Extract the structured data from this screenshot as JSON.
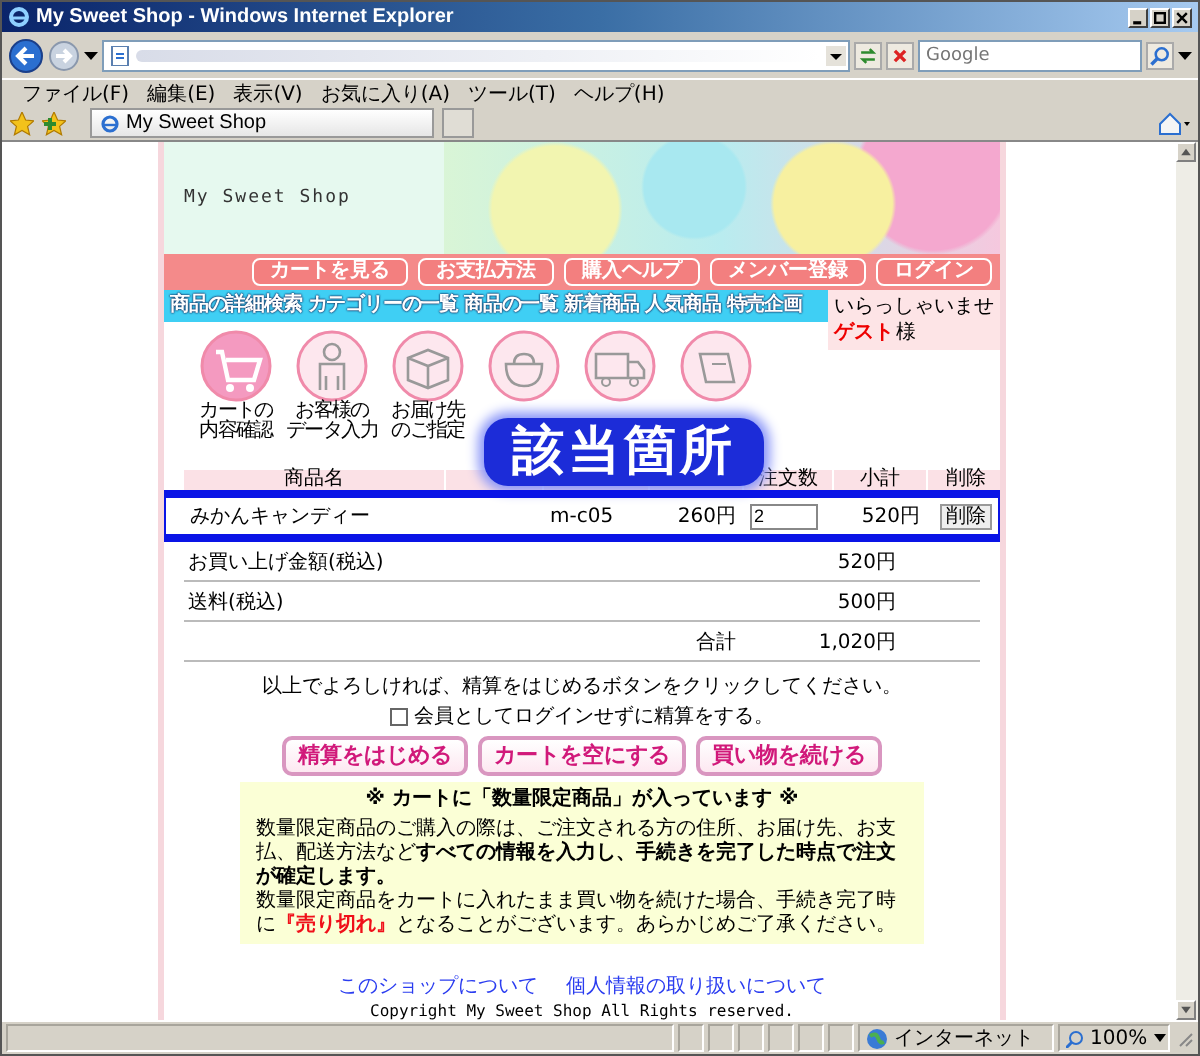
{
  "window": {
    "title": "My Sweet Shop - Windows Internet Explorer"
  },
  "search": {
    "placeholder": "Google"
  },
  "menu": [
    "ファイル(F)",
    "編集(E)",
    "表示(V)",
    "お気に入り(A)",
    "ツール(T)",
    "ヘルプ(H)"
  ],
  "tab": {
    "label": "My Sweet Shop"
  },
  "site": {
    "logo": "My Sweet Shop",
    "top_nav": [
      "カートを見る",
      "お支払方法",
      "購入ヘルプ",
      "メンバー登録",
      "ログイン"
    ],
    "sub_nav": [
      "商品の詳細検索",
      "カテゴリーの一覧",
      "商品の一覧",
      "新着商品",
      "人気商品",
      "特売企画"
    ],
    "greeting": {
      "text": "いらっしゃいませ",
      "user": "ゲスト",
      "suffix": "様"
    }
  },
  "steps": [
    {
      "label": [
        "カートの",
        "内容確認"
      ],
      "selected": true
    },
    {
      "label": [
        "お客様の",
        "データ入力"
      ],
      "selected": false
    },
    {
      "label": [
        "お届け先",
        "のご指定"
      ],
      "selected": false
    },
    {
      "selected": false
    },
    {
      "selected": false
    },
    {
      "selected": false
    }
  ],
  "callout": "該当箇所",
  "cart": {
    "columns": [
      "商品名",
      null,
      null,
      null,
      "注文数",
      "小計",
      "削除"
    ],
    "rows": [
      {
        "name": "みかんキャンディー",
        "model": "m-c05",
        "price": "260円",
        "quantity": "2",
        "subtotal": "520円",
        "remove": "削除"
      }
    ],
    "summary": [
      {
        "kind": "line",
        "label": "お買い上げ金額(税込)",
        "value": "520円"
      },
      {
        "kind": "line",
        "label": "送料(税込)",
        "value": "500円"
      },
      {
        "kind": "total",
        "label": "合計",
        "value": "1,020円"
      }
    ]
  },
  "instruction": "以上でよろしければ、精算をはじめるボタンをクリックしてください。",
  "guest_checkout": {
    "label": "会員としてログインせずに精算をする。",
    "checked": false
  },
  "buttons": [
    "精算をはじめる",
    "カートを空にする",
    "買い物を続ける"
  ],
  "notice": {
    "title": "※ カートに「数量限定商品」が入っています ※",
    "text_1": "数量限定商品のご購入の際は、ご注文される方の住所、お届け先、お支払、配送方法など**すべての情報を入力し、手続きを完了した時点で注文が確定します。**",
    "text_2": "数量限定商品をカートに入れたまま買い物を続けた場合、手続き完了時に**『売り切れ』**となることがございます。あらかじめご了承ください。"
  },
  "footer": {
    "links": [
      "このショップについて",
      "個人情報の取り扱いについて"
    ],
    "copyright": "Copyright My Sweet Shop All Rights reserved."
  },
  "status_bar": {
    "zone": "インターネット",
    "zoom": "100%"
  }
}
